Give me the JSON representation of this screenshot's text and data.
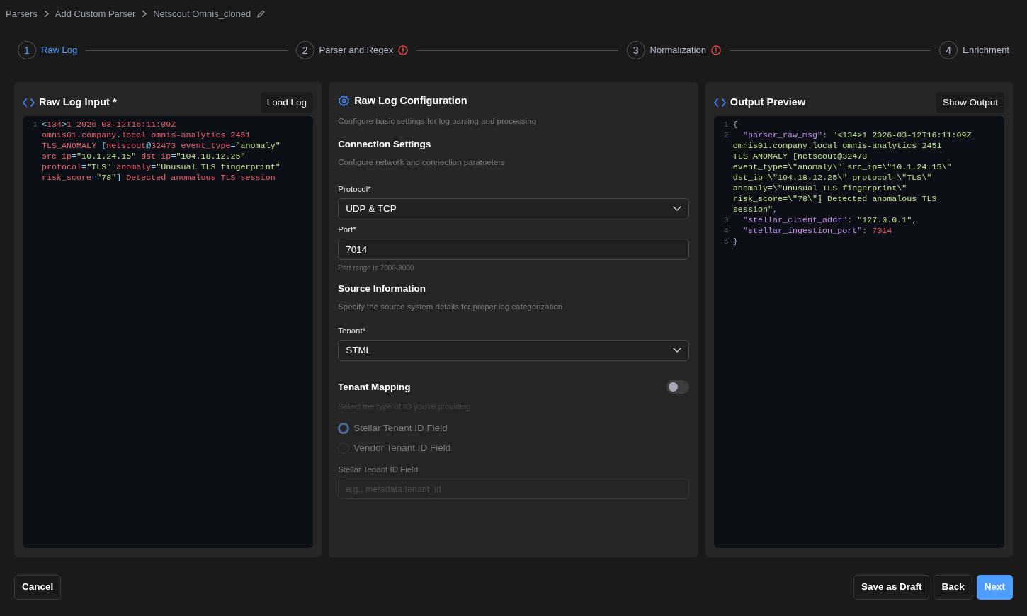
{
  "breadcrumbs": [
    {
      "label": "Parsers"
    },
    {
      "label": "Add Custom Parser"
    },
    {
      "label": "Netscout Omnis_cloned",
      "editable": true
    }
  ],
  "steps": [
    {
      "number": "1",
      "label": "Raw Log",
      "selected": true,
      "error": false
    },
    {
      "number": "2",
      "label": "Parser and Regex",
      "selected": false,
      "error": true
    },
    {
      "number": "3",
      "label": "Normalization",
      "selected": false,
      "error": true
    },
    {
      "number": "4",
      "label": "Enrichment",
      "selected": false,
      "error": false
    }
  ],
  "raw_log": {
    "title": "Raw Log Input *",
    "button": "Load Log",
    "lines": [
      {
        "number": "1",
        "rows": [
          "<134>1 2026-03-12T16:11:09Z",
          "omnis01.company.local omnis-analytics 2451",
          "TLS_ANOMALY [netscout@32473 event_type=\"anomaly\"",
          "src_ip=\"10.1.24.15\" dst_ip=\"104.18.12.25\"",
          "protocol=\"TLS\" anomaly=\"Unusual TLS fingerprint\"",
          "risk_score=\"78\"] Detected anomalous TLS session"
        ]
      }
    ]
  },
  "config": {
    "title": "Raw Log Configuration",
    "subtitle": "Configure basic settings for log parsing and processing",
    "connection": {
      "title": "Connection Settings",
      "subtitle": "Configure network and connection parameters",
      "protocol": {
        "label": "Protocol*",
        "value": "UDP & TCP"
      },
      "port": {
        "label": "Port*",
        "value": "7014",
        "hint": "Port range is 7000-8000"
      }
    },
    "source": {
      "title": "Source Information",
      "subtitle": "Specify the source system details for proper log categorization",
      "tenant": {
        "label": "Tenant*",
        "value": "STML"
      }
    },
    "mapping": {
      "title": "Tenant Mapping",
      "on": false,
      "subtitle": "Select the type of ID you're providing",
      "options": [
        {
          "label": "Stellar Tenant ID Field",
          "selected": true
        },
        {
          "label": "Vendor Tenant ID Field",
          "selected": false
        }
      ],
      "field": {
        "label": "Stellar Tenant ID Field",
        "placeholder": "e.g., metadata.tenant_id"
      }
    }
  },
  "output": {
    "title": "Output Preview",
    "button": "Show Output",
    "lines": [
      {
        "number": "1",
        "rows": [
          "{"
        ]
      },
      {
        "number": "2",
        "rows": [
          "  \"parser_raw_msg\": \"<134>1 2026-03-12T16:11:09Z",
          "omnis01.company.local omnis-analytics 2451",
          "TLS_ANOMALY [netscout@32473",
          "event_type=\\\"anomaly\\\" src_ip=\\\"10.1.24.15\\\"",
          "dst_ip=\\\"104.18.12.25\\\" protocol=\\\"TLS\\\"",
          "anomaly=\\\"Unusual TLS fingerprint\\\"",
          "risk_score=\\\"78\\\"] Detected anomalous TLS",
          "session\","
        ]
      },
      {
        "number": "3",
        "rows": [
          "  \"stellar_client_addr\": \"127.0.0.1\","
        ]
      },
      {
        "number": "4",
        "rows": [
          "  \"stellar_ingestion_port\": 7014"
        ]
      },
      {
        "number": "5",
        "rows": [
          "}"
        ]
      }
    ]
  },
  "footer": {
    "cancel": "Cancel",
    "draft": "Save as Draft",
    "back": "Back",
    "next": "Next"
  }
}
